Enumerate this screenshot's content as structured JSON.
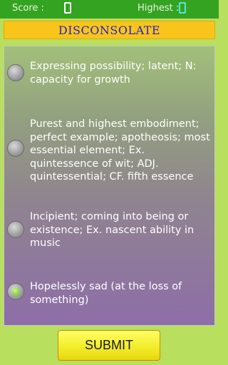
{
  "header": {
    "score_label": "Score :",
    "highest_label": "Highest :"
  },
  "word": "DISCONSOLATE",
  "options": [
    {
      "text": "Expressing possibility; latent; N: capacity for growth",
      "selected": false
    },
    {
      "text": "Purest and highest embodiment; perfect example; apotheosis; most essential element; Ex. quintessence of wit; ADJ. quintessential; CF. fifth essence",
      "selected": false
    },
    {
      "text": "Incipient; coming into being or existence; Ex. nascent ability in music",
      "selected": false
    },
    {
      "text": "Hopelessly sad (at the loss of something)",
      "selected": true
    }
  ],
  "submit_label": "SUBMIT",
  "colors": {
    "topbar": "#34a321",
    "background": "#b8df5e",
    "banner": "#f9c51b",
    "word_text": "#2323c6",
    "submit": "#f3ed2b"
  }
}
